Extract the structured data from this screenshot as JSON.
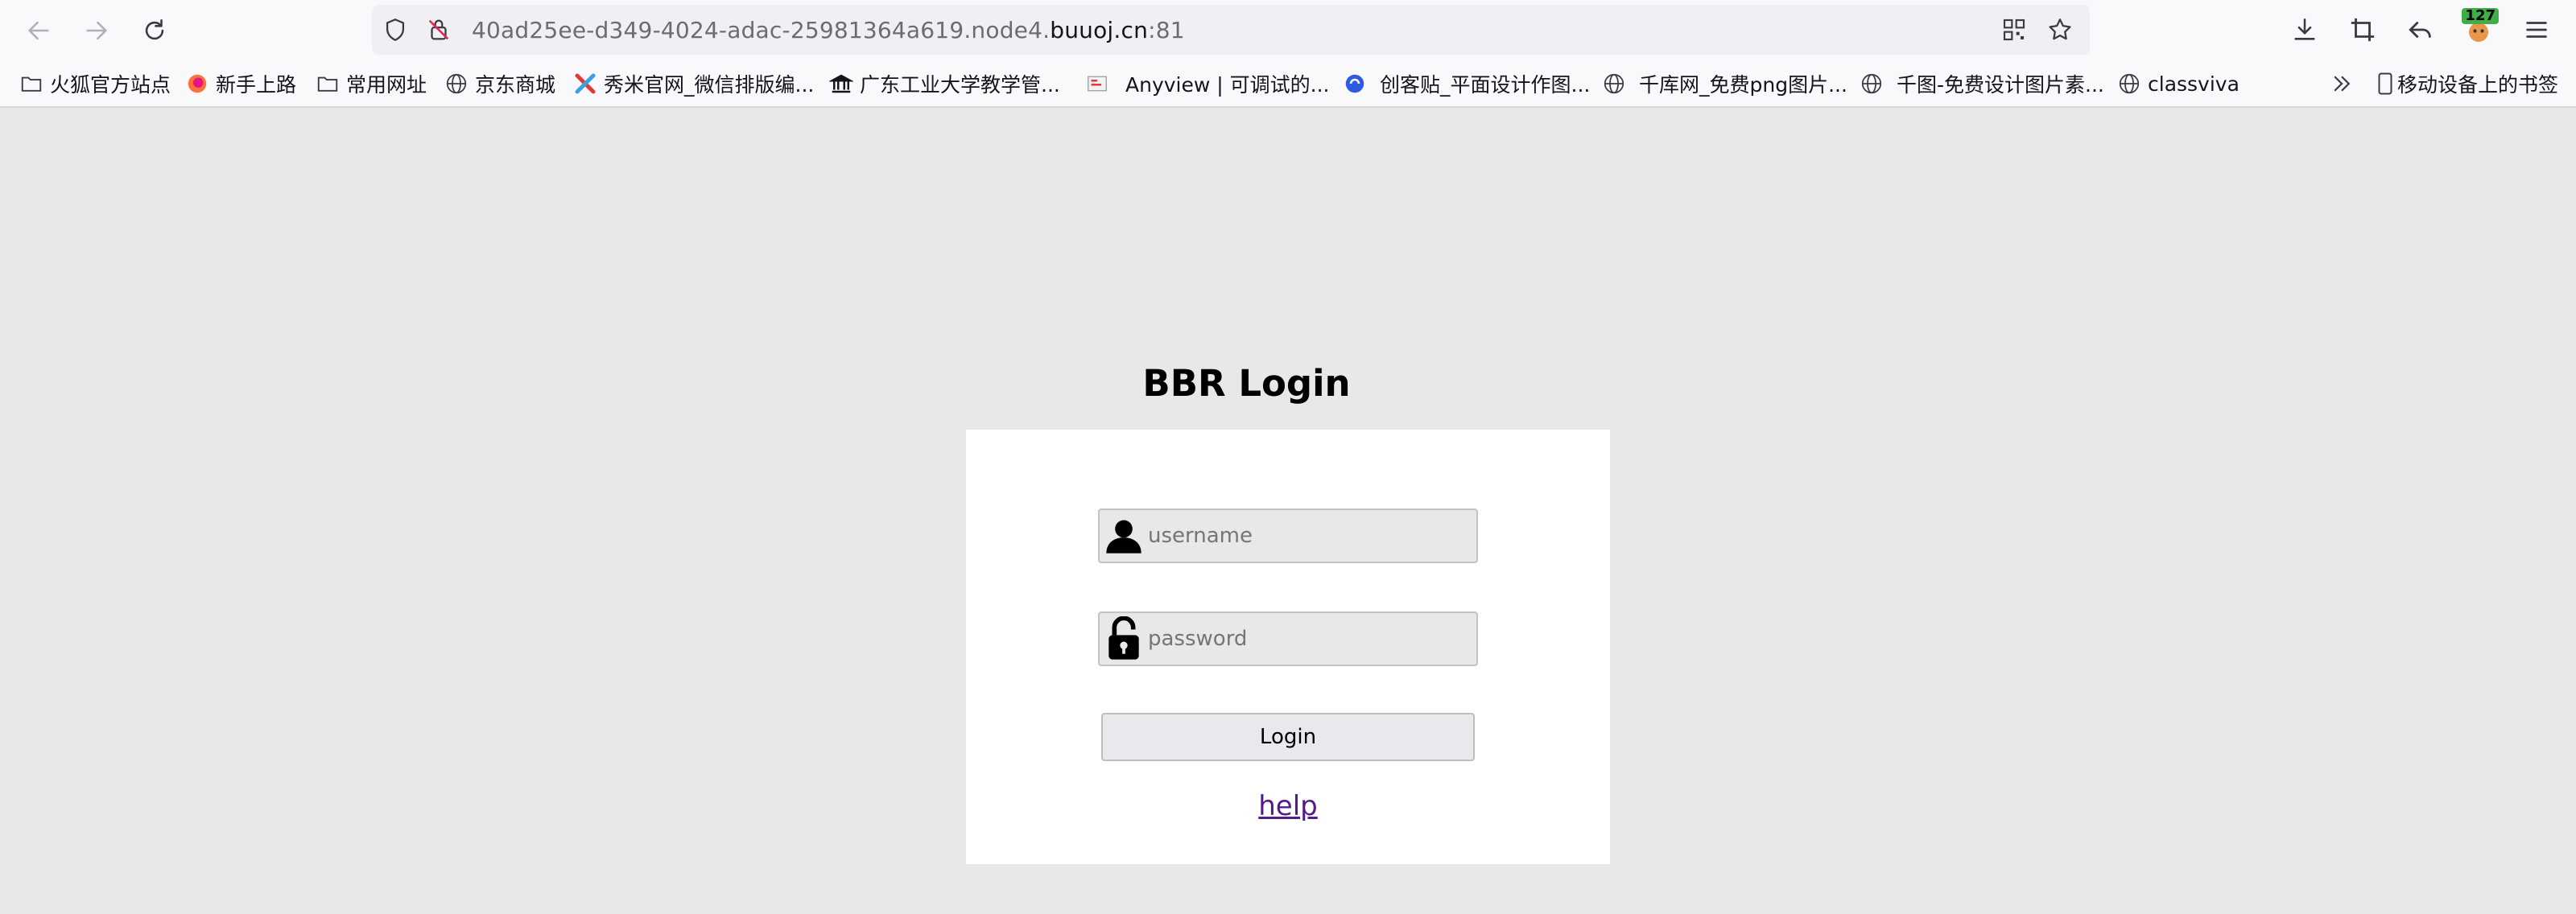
{
  "browser": {
    "url_prefix": "40ad25ee-d349-4024-adac-25981364a619.node4.",
    "url_host": "buuoj.cn",
    "url_port": ":81",
    "extension_badge": "127",
    "bookmarks": [
      {
        "label": "火狐官方站点",
        "icon": "folder-icon"
      },
      {
        "label": "新手上路",
        "icon": "firefox-icon"
      },
      {
        "label": "常用网址",
        "icon": "folder-icon"
      },
      {
        "label": "京东商城",
        "icon": "globe-icon"
      },
      {
        "label": "秀米官网_微信排版编...",
        "icon": "xiumi-icon"
      },
      {
        "label": "广东工业大学教学管...",
        "icon": "bank-icon"
      },
      {
        "label": "Anyview | 可调试的...",
        "icon": "anyview-icon"
      },
      {
        "label": "创客贴_平面设计作图...",
        "icon": "chuangkit-icon"
      },
      {
        "label": "千库网_免费png图片...",
        "icon": "globe-icon"
      },
      {
        "label": "千图-免费设计图片素...",
        "icon": "globe-icon"
      },
      {
        "label": "classviva",
        "icon": "globe-icon"
      }
    ],
    "mobile_bookmarks": "移动设备上的书签"
  },
  "page": {
    "title": "BBR Login",
    "username_placeholder": "username",
    "password_placeholder": "password",
    "login_label": "Login",
    "help_label": "help"
  },
  "colors": {
    "page_bg": "#e8e8e8",
    "card_bg": "#ffffff",
    "link": "#551a8b"
  }
}
